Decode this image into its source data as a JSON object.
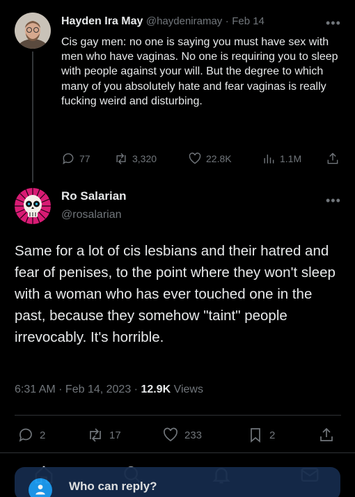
{
  "parent_tweet": {
    "name": "Hayden Ira May",
    "handle": "@haydeniramay",
    "separator": "·",
    "date": "Feb 14",
    "text": "Cis gay men: no one is saying you must have sex with men who have vaginas. No one is requiring you to sleep with people against your will. But the degree to which many of you absolutely hate and fear vaginas is really fucking weird and disturbing.",
    "replies": "77",
    "retweets": "3,320",
    "likes": "22.8K",
    "views": "1.1M"
  },
  "main_tweet": {
    "name": "Ro Salarian",
    "handle": "@rosalarian",
    "text": "Same for a lot of cis lesbians and their hatred and fear of penises, to the point where they won't sleep with a woman who has ever touched one in the past, because they somehow \"taint\" people irrevocably. It's horrible.",
    "timestamp": "6:31 AM · Feb 14, 2023 · ",
    "views_count": "12.9K",
    "views_label": " Views",
    "replies": "2",
    "retweets": "17",
    "likes": "233",
    "bookmarks": "2"
  },
  "reply_bar": {
    "label": "Who can reply?"
  },
  "colors": {
    "background": "#000000",
    "text_primary": "#e7e9ea",
    "text_secondary": "#71767b",
    "accent": "#1d9bf0",
    "divider": "#2f3336"
  }
}
